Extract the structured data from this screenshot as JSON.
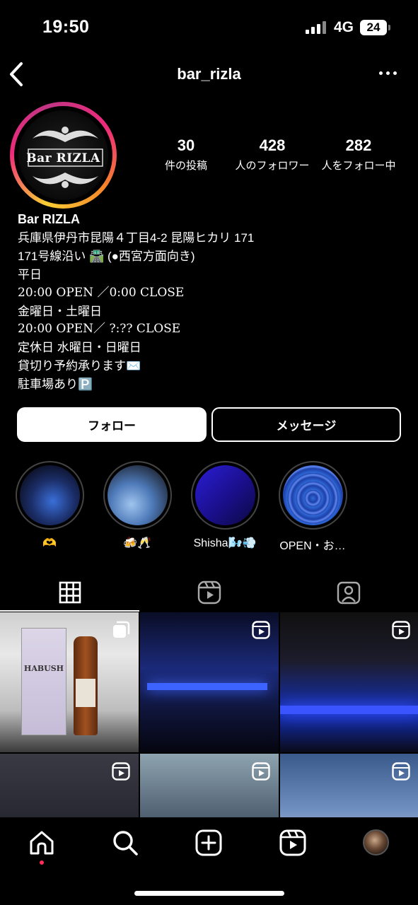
{
  "status": {
    "time": "19:50",
    "network": "4G",
    "battery": "24"
  },
  "nav": {
    "title": "bar_rizla"
  },
  "profile": {
    "avatar_logo": "Bar RIZLA",
    "stats": [
      {
        "value": "30",
        "label": "件の投稿"
      },
      {
        "value": "428",
        "label": "人のフォロワー"
      },
      {
        "value": "282",
        "label": "人をフォロー中"
      }
    ],
    "name": "Bar RIZLA",
    "bio": [
      "兵庫県伊丹市昆陽４丁目4-2 昆陽ヒカリ 171",
      "171号線沿い 🛣️ (●西宮方面向き)",
      "平日",
      "20:00 OPEN ／0:00 CLOSE",
      "金曜日・土曜日",
      "20:00 OPEN／ ?:?? CLOSE",
      "定休日 水曜日・日曜日",
      "貸切り予約承ります✉️",
      "駐車場あり🅿️"
    ]
  },
  "actions": {
    "follow": "フォロー",
    "message": "メッセージ"
  },
  "highlights": [
    {
      "label": "🫶"
    },
    {
      "label": "🍻🥂"
    },
    {
      "label": "Shisha🌬️💨"
    },
    {
      "label": "OPEN・お…"
    }
  ],
  "tabs": [
    "posts-grid",
    "reels",
    "tagged"
  ],
  "grid": [
    {
      "type": "carousel",
      "text": "HABUSH"
    },
    {
      "type": "reel"
    },
    {
      "type": "reel"
    },
    {
      "type": "reel"
    },
    {
      "type": "reel"
    },
    {
      "type": "reel"
    }
  ],
  "bottom_nav": [
    "home",
    "search",
    "create",
    "reels",
    "profile"
  ]
}
